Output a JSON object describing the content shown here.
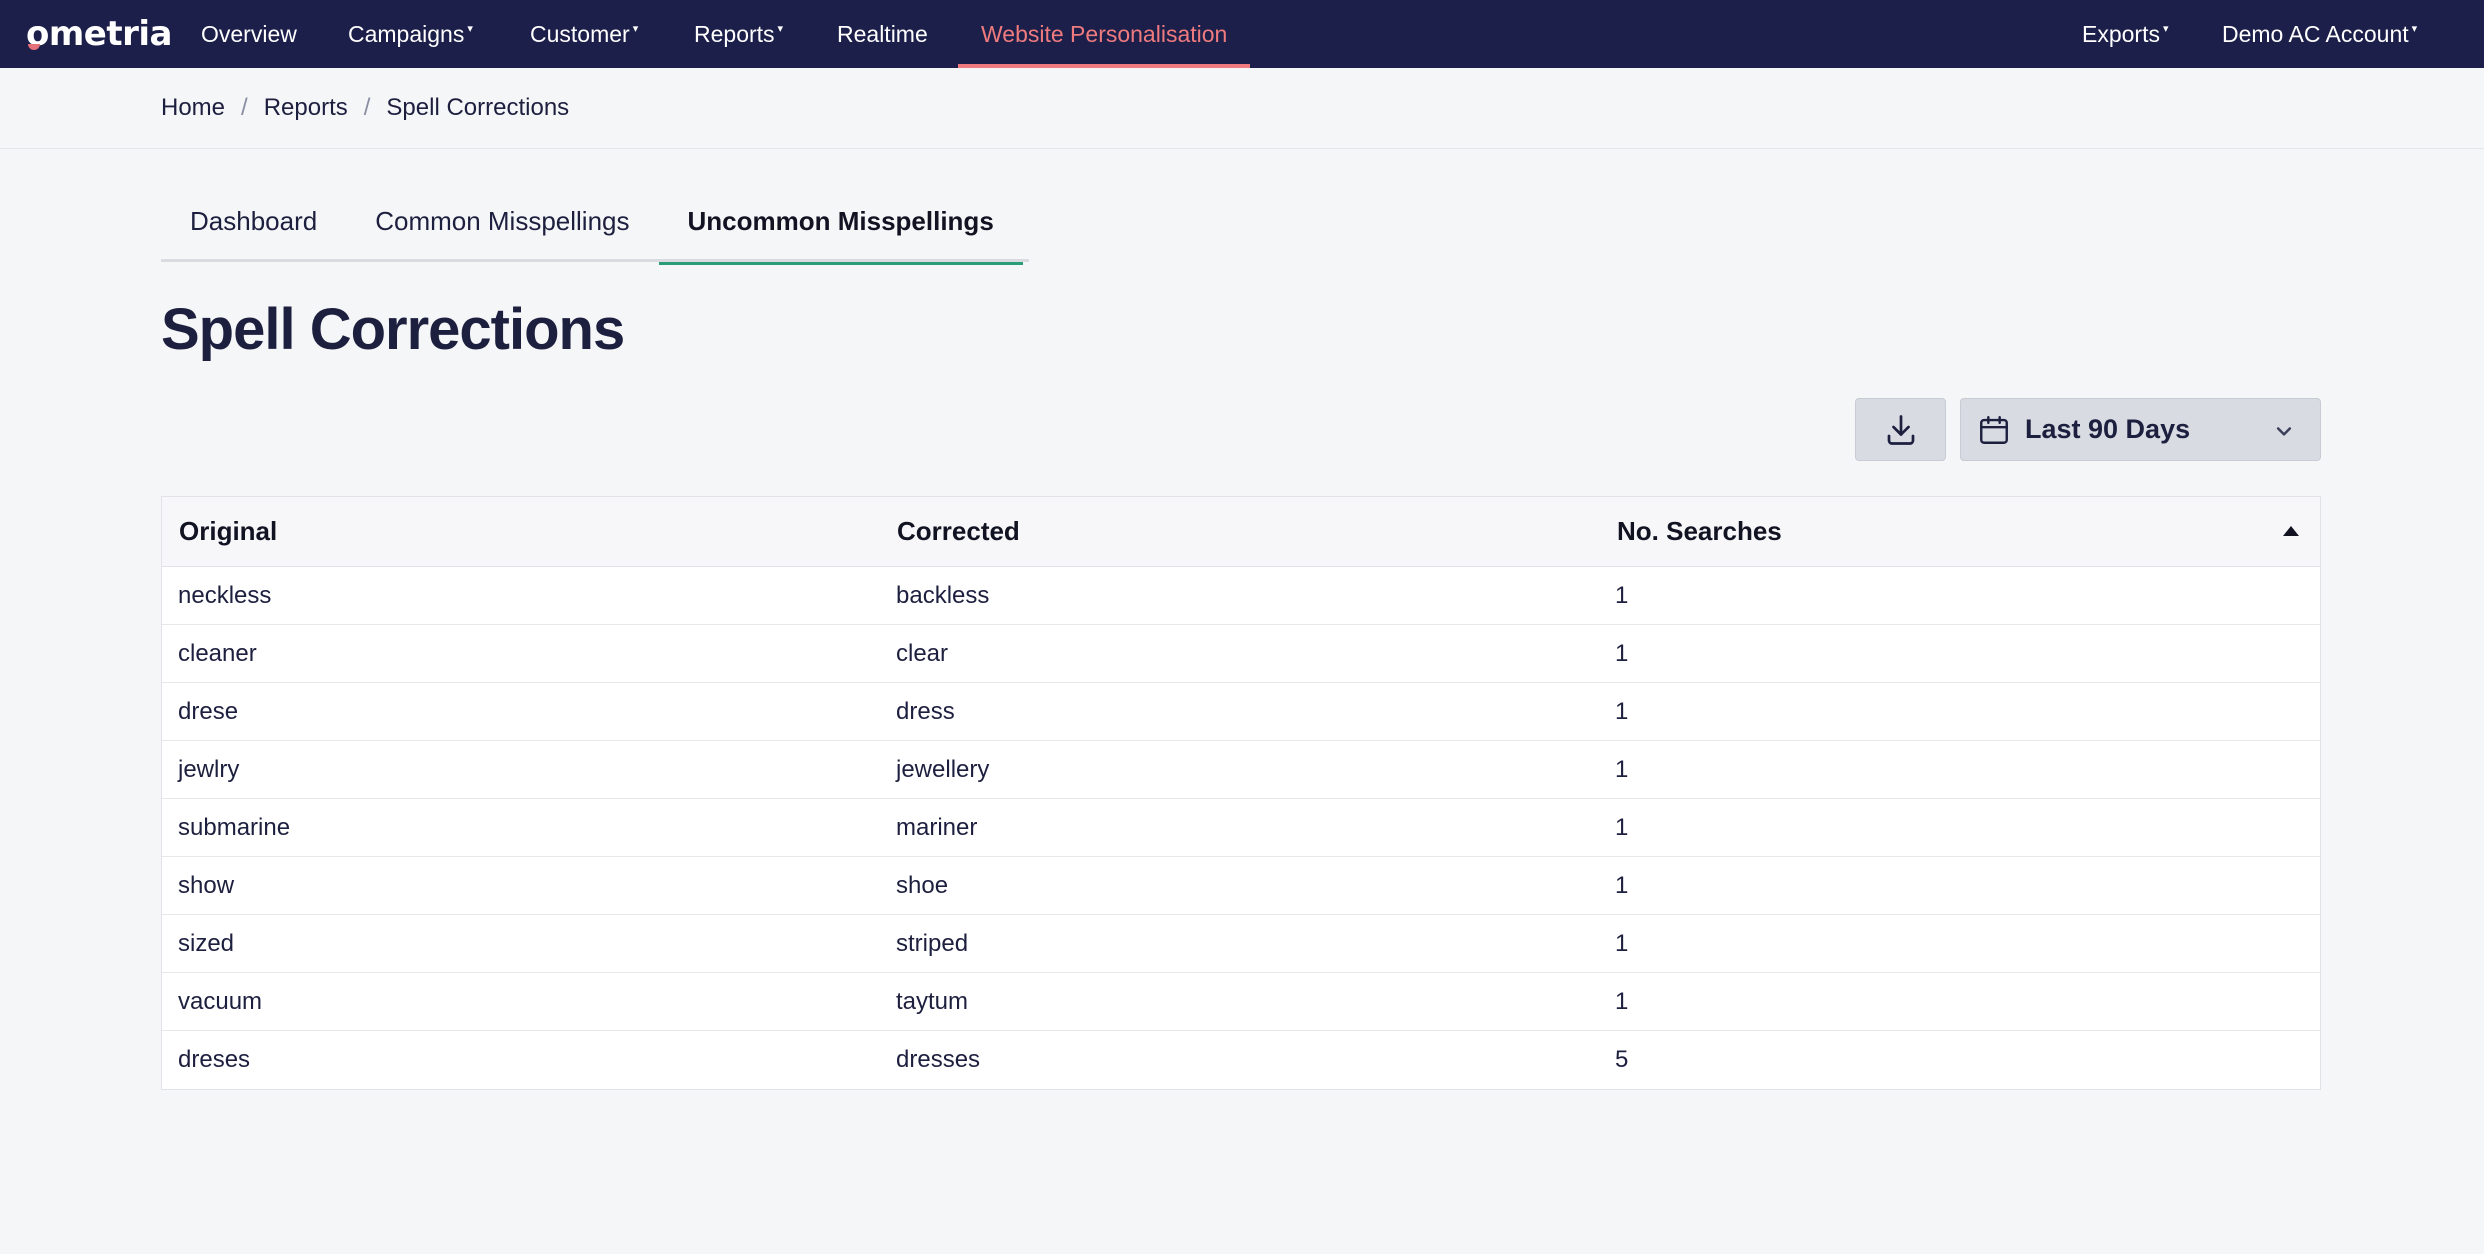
{
  "brand": {
    "logo": "ometria"
  },
  "nav": {
    "items": [
      {
        "label": "Overview",
        "caret": false
      },
      {
        "label": "Campaigns",
        "caret": true
      },
      {
        "label": "Customer",
        "caret": true
      },
      {
        "label": "Reports",
        "caret": true
      },
      {
        "label": "Realtime",
        "caret": false
      },
      {
        "label": "Website Personalisation",
        "caret": false,
        "active": true
      }
    ],
    "right": [
      {
        "label": "Exports",
        "caret": true
      },
      {
        "label": "Demo AC Account",
        "caret": true
      }
    ],
    "caret_glyph": "▾",
    "active_color": "#ef7b7e",
    "bg_color": "#1c1f4a"
  },
  "breadcrumb": {
    "items": [
      "Home",
      "Reports",
      "Spell Corrections"
    ],
    "separator": "/"
  },
  "tabs": {
    "items": [
      "Dashboard",
      "Common Misspellings",
      "Uncommon Misspellings"
    ],
    "active_index": 2,
    "active_color": "#2a9d78"
  },
  "page": {
    "title": "Spell Corrections"
  },
  "toolbar": {
    "download_icon": "download-icon",
    "date_range": {
      "selected": "Last 90 Days",
      "icon": "calendar-icon"
    }
  },
  "table": {
    "columns": [
      "Original",
      "Corrected",
      "No. Searches"
    ],
    "sort_indicator": "sort-asc-icon",
    "rows": [
      {
        "original": "neckless",
        "corrected": "backless",
        "searches": "1"
      },
      {
        "original": "cleaner",
        "corrected": "clear",
        "searches": "1"
      },
      {
        "original": "drese",
        "corrected": "dress",
        "searches": "1"
      },
      {
        "original": "jewlry",
        "corrected": "jewellery",
        "searches": "1"
      },
      {
        "original": "submarine",
        "corrected": "mariner",
        "searches": "1"
      },
      {
        "original": "show",
        "corrected": "shoe",
        "searches": "1"
      },
      {
        "original": "sized",
        "corrected": "striped",
        "searches": "1"
      },
      {
        "original": "vacuum",
        "corrected": "taytum",
        "searches": "1"
      },
      {
        "original": "dreses",
        "corrected": "dresses",
        "searches": "5"
      }
    ]
  }
}
